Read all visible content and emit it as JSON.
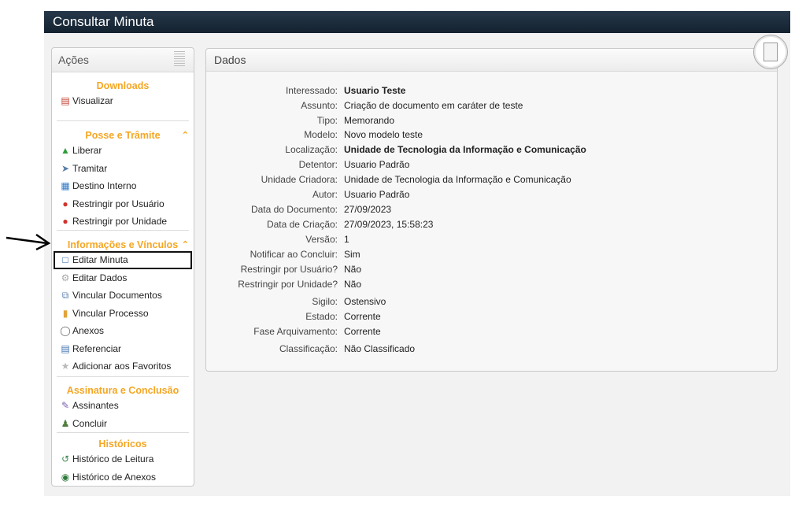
{
  "page_title": "Consultar Minuta",
  "sidebar": {
    "header": "Ações",
    "sections": [
      {
        "title": "Downloads",
        "items": [
          {
            "label": "Visualizar",
            "icon": "pdf-icon"
          }
        ]
      },
      {
        "title": "Posse e Trâmite",
        "items": [
          {
            "label": "Liberar",
            "icon": "release-icon"
          },
          {
            "label": "Tramitar",
            "icon": "send-icon"
          },
          {
            "label": "Destino Interno",
            "icon": "calendar-icon"
          },
          {
            "label": "Restringir por Usuário",
            "icon": "restrict-user-icon"
          },
          {
            "label": "Restringir por Unidade",
            "icon": "restrict-unit-icon"
          }
        ]
      },
      {
        "title": "Informações e Vínculos",
        "items": [
          {
            "label": "Editar Minuta",
            "icon": "word-doc-icon"
          },
          {
            "label": "Editar Dados",
            "icon": "gear-icon"
          },
          {
            "label": "Vincular Documentos",
            "icon": "link-docs-icon"
          },
          {
            "label": "Vincular Processo",
            "icon": "folder-icon"
          },
          {
            "label": "Anexos",
            "icon": "paperclip-icon"
          },
          {
            "label": "Referenciar",
            "icon": "reference-icon"
          },
          {
            "label": "Adicionar aos Favoritos",
            "icon": "star-icon"
          }
        ]
      },
      {
        "title": "Assinatura e Conclusão",
        "items": [
          {
            "label": "Assinantes",
            "icon": "pen-icon"
          },
          {
            "label": "Concluir",
            "icon": "users-icon"
          }
        ]
      },
      {
        "title": "Históricos",
        "items": [
          {
            "label": "Histórico de Leitura",
            "icon": "history-read-icon"
          },
          {
            "label": "Histórico de Anexos",
            "icon": "history-attach-icon"
          }
        ]
      }
    ]
  },
  "panel": {
    "title": "Dados",
    "fields": [
      {
        "label": "Interessado:",
        "value": "Usuario Teste",
        "bold": true
      },
      {
        "label": "Assunto:",
        "value": "Criação de documento em caráter de teste"
      },
      {
        "label": "Tipo:",
        "value": "Memorando"
      },
      {
        "label": "Modelo:",
        "value": "Novo modelo teste"
      },
      {
        "label": "Localização:",
        "value": "Unidade de Tecnologia da Informação e Comunicação",
        "bold": true
      },
      {
        "label": "Detentor:",
        "value": "Usuario Padrão"
      },
      {
        "label": "Unidade Criadora:",
        "value": "Unidade de Tecnologia da Informação e Comunicação"
      },
      {
        "label": "Autor:",
        "value": "Usuario Padrão"
      },
      {
        "label": "Data do Documento:",
        "value": "27/09/2023"
      },
      {
        "label": "Data de Criação:",
        "value": "27/09/2023, 15:58:23"
      },
      {
        "label": "Versão:",
        "value": "1"
      },
      {
        "label": "Notificar ao Concluir:",
        "value": "Sim"
      },
      {
        "label": "Restringir por Usuário?",
        "value": "Não"
      },
      {
        "label": "Restringir por Unidade?",
        "value": "Não"
      },
      {
        "label": "Sigilo:",
        "value": "Ostensivo"
      },
      {
        "label": "Estado:",
        "value": "Corrente"
      },
      {
        "label": "Fase Arquivamento:",
        "value": "Corrente"
      },
      {
        "label": "Classificação:",
        "value": "Não Classificado"
      }
    ]
  },
  "colors": {
    "section_title": "#f5a623",
    "titlebar": "#1b2a38"
  }
}
